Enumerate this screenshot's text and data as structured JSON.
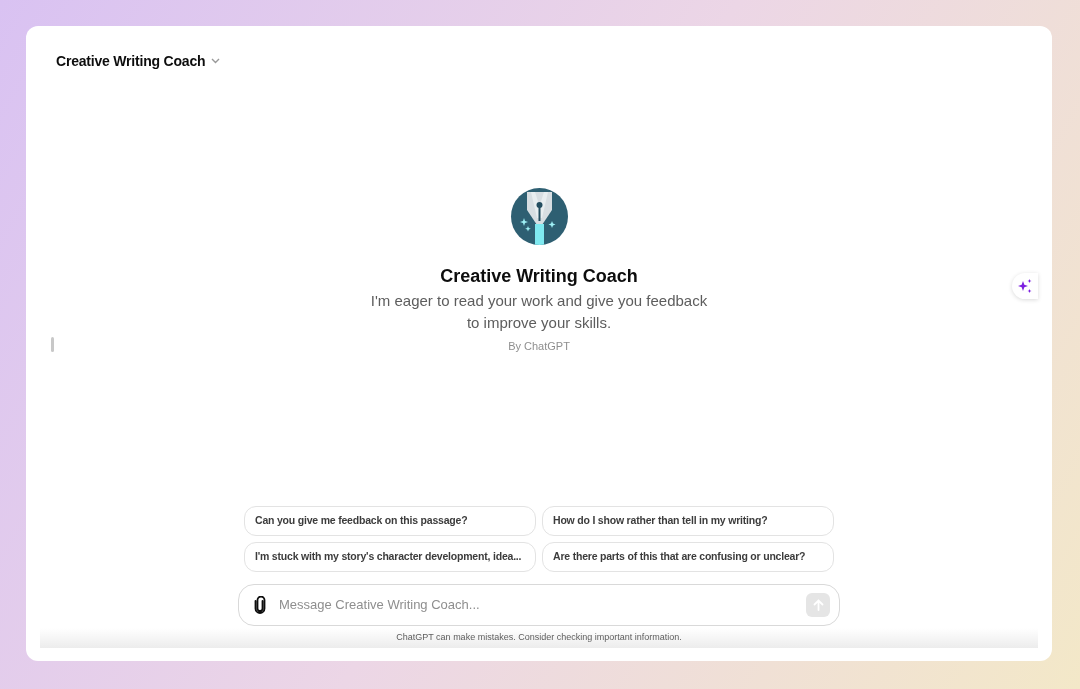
{
  "header": {
    "title": "Creative Writing Coach"
  },
  "intro": {
    "name": "Creative Writing Coach",
    "description": "I'm eager to read your work and give you feedback to improve your skills.",
    "author": "By ChatGPT"
  },
  "suggestions": [
    {
      "text": "Can you give me feedback on this passage?"
    },
    {
      "text": "How do I show rather than tell in my writing?"
    },
    {
      "text": "I'm stuck with my story's character development, idea..."
    },
    {
      "text": "Are there parts of this that are confusing or unclear?"
    }
  ],
  "composer": {
    "placeholder": "Message Creative Writing Coach...",
    "send_disabled": true
  },
  "footer": {
    "note": "ChatGPT can make mistakes. Consider checking important information."
  }
}
